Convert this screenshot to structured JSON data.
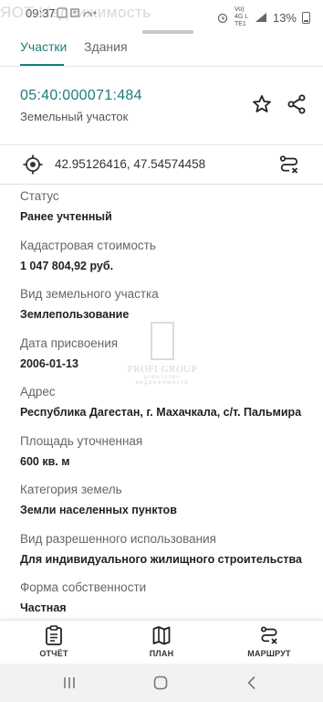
{
  "status_bar": {
    "time": "09:37",
    "overlay_text": "ЯОТ Недвижимость",
    "network": "Vo) 4G LTE1",
    "battery": "13%"
  },
  "tabs": [
    {
      "label": "Участки",
      "active": true
    },
    {
      "label": "Здания",
      "active": false
    }
  ],
  "header": {
    "cadastral_number": "05:40:000071:484",
    "object_type": "Земельный участок"
  },
  "coordinates": {
    "text": "42.95126416, 47.54574458"
  },
  "fields": [
    {
      "label": "Статус",
      "value": "Ранее учтенный"
    },
    {
      "label": "Кадастровая стоимость",
      "value": "1 047 804,92 руб."
    },
    {
      "label": "Вид земельного участка",
      "value": "Землепользование"
    },
    {
      "label": "Дата присвоения",
      "value": "2006-01-13"
    },
    {
      "label": "Адрес",
      "value": "Республика Дагестан, г. Махачкала, с/т. Пальмира"
    },
    {
      "label": "Площадь уточненная",
      "value": "600 кв. м"
    },
    {
      "label": "Категория земель",
      "value": "Земли населенных пунктов"
    },
    {
      "label": "Вид разрешенного использования",
      "value": "Для индивидуального жилищного строительства"
    },
    {
      "label": "Форма собственности",
      "value": "Частная"
    }
  ],
  "watermark": {
    "text": "PROFI GROUP",
    "subtext": "агентство недвижимости"
  },
  "bottom_nav": [
    {
      "label": "ОТЧЁТ",
      "icon": "report-icon"
    },
    {
      "label": "ПЛАН",
      "icon": "map-icon"
    },
    {
      "label": "МАРШРУТ",
      "icon": "route-icon"
    }
  ],
  "colors": {
    "accent": "#1b7d78"
  }
}
